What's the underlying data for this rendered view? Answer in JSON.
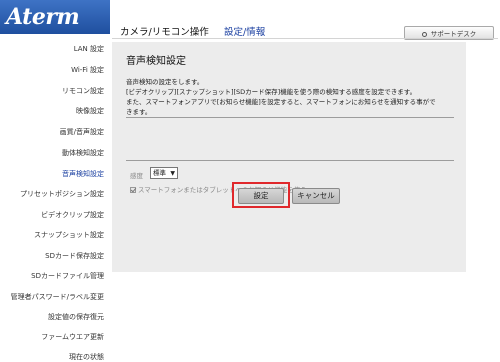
{
  "header": {
    "logo": "Aterm",
    "title": "カメラ/リモコン操作",
    "settings_link": "設定/情報",
    "support_button": "サポートデスク"
  },
  "sidebar": {
    "items": [
      {
        "label": "LAN 設定",
        "active": false
      },
      {
        "label": "Wi-Fi 設定",
        "active": false
      },
      {
        "label": "リモコン設定",
        "active": false
      },
      {
        "label": "映像設定",
        "active": false
      },
      {
        "label": "画質/音声設定",
        "active": false
      },
      {
        "label": "動体検知設定",
        "active": false
      },
      {
        "label": "音声検知設定",
        "active": true
      },
      {
        "label": "プリセットポジション設定",
        "active": false
      },
      {
        "label": "ビデオクリップ設定",
        "active": false
      },
      {
        "label": "スナップショット設定",
        "active": false
      },
      {
        "label": "SDカード保存設定",
        "active": false
      },
      {
        "label": "SDカードファイル管理",
        "active": false
      },
      {
        "label": "管理者パスワード/ラベル変更",
        "active": false
      },
      {
        "label": "設定値の保存復元",
        "active": false
      },
      {
        "label": "ファームウエア更新",
        "active": false
      },
      {
        "label": "現在の状態",
        "active": false
      }
    ]
  },
  "main": {
    "title": "音声検知設定",
    "description": [
      "音声検知の設定をします。",
      "[ビデオクリップ][スナップショット][SDカード保存]機能を使う際の検知する感度を設定できます。",
      "また、スマートフォンアプリで[お知らせ機能]を設定すると、スマートフォンにお知らせを通知する事がで",
      "きます。"
    ],
    "sensitivity_label": "感度",
    "sensitivity_value": "標準",
    "notify_label": "スマートフォンまたはタブレットへのお知らせ機能を使う",
    "notify_checked": true,
    "save_button": "設定",
    "cancel_button": "キャンセル"
  },
  "colors": {
    "brand": "#1f4f9f",
    "link": "#1a3fa0",
    "highlight": "#e0282c",
    "panel_bg": "#ececec"
  }
}
